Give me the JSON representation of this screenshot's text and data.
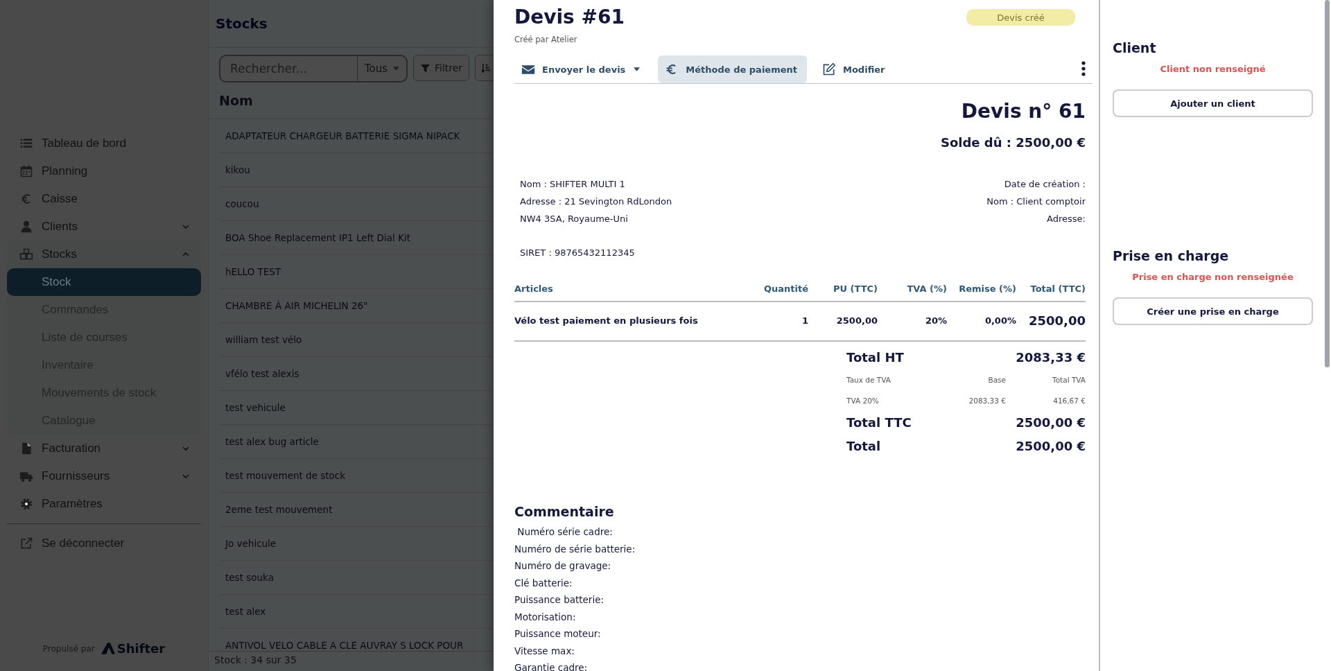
{
  "sidebar": {
    "items": [
      {
        "label": "Tableau de bord",
        "selected": false
      },
      {
        "label": "Planning",
        "selected": false
      },
      {
        "label": "Caisse",
        "selected": false
      },
      {
        "label": "Clients",
        "selected": false,
        "expanded": false
      },
      {
        "label": "Stocks",
        "selected": false,
        "expanded": true,
        "children": [
          {
            "label": "Stock",
            "selected": true
          },
          {
            "label": "Commandes",
            "selected": false
          },
          {
            "label": "Liste de courses",
            "selected": false
          },
          {
            "label": "Inventaire",
            "selected": false
          },
          {
            "label": "Mouvements de stock",
            "selected": false
          },
          {
            "label": "Catalogue",
            "selected": false
          }
        ]
      },
      {
        "label": "Facturation",
        "selected": false,
        "expanded": false
      },
      {
        "label": "Fournisseurs",
        "selected": false,
        "expanded": false
      },
      {
        "label": "Paramètres",
        "selected": false
      }
    ],
    "logout": "Se déconnecter",
    "footer": {
      "powered_by": "Propulsé par",
      "brand": "Shifter"
    }
  },
  "stock_list": {
    "title": "Stocks",
    "search": {
      "placeholder": "Rechercher...",
      "scope": "Tous"
    },
    "filter_button": "Filtrer",
    "columns": [
      "Nom"
    ],
    "rows": [
      "ADAPTATEUR CHARGEUR BATTERIE SIGMA NIPACK",
      "kikou",
      "coucou",
      "BOA Shoe Replacement IP1 Left Dial Kit",
      "hELLO TEST",
      "CHAMBRE À AIR MICHELIN 26\"",
      "william test vélo",
      "vfélo test alexis",
      "test vehicule",
      "test alex bug article",
      "test mouvement de stock",
      "2eme test mouvement",
      "Jo vehicule",
      "test souka",
      "test alex",
      "ANTIVOL VELO CABLE A CLE AUVRAY S LOCK POUR"
    ],
    "footer": "Stock : 34 sur 35"
  },
  "quote": {
    "title": "Devis #61",
    "status": "Devis créé",
    "created_by": "Créé par Atelier",
    "actions": [
      {
        "label": "Envoyer le devis",
        "kind": "send",
        "selected": false
      },
      {
        "label": "Méthode de paiement",
        "kind": "payment",
        "selected": true
      },
      {
        "label": "Modifier",
        "kind": "edit",
        "selected": false
      }
    ],
    "document": {
      "heading": "Devis n° 61",
      "balance": "Solde dû : 2500,00 €",
      "issuer": [
        "Nom : SHIFTER MULTI 1",
        "Adresse : 21 Sevington RdLondon",
        "NW4 3SA, Royaume-Uni"
      ],
      "siret": "SIRET : 98765432112345",
      "recipient": [
        "Date de création :",
        "Nom : Client comptoir",
        "Adresse:"
      ],
      "table": {
        "columns": [
          "Articles",
          "Quantité",
          "PU (TTC)",
          "TVA (%)",
          "Remise (%)",
          "Total (TTC)"
        ],
        "rows": [
          [
            "Vélo test paiement en plusieurs fois",
            "1",
            "2500,00",
            "20%",
            "0,00%",
            "2500,00"
          ]
        ]
      },
      "totals": {
        "total_ht": {
          "label": "Total HT",
          "value": "2083,33 €"
        },
        "vat_columns": [
          "Taux de TVA",
          "Base",
          "Total TVA"
        ],
        "vat_rows": [
          [
            "TVA 20%",
            "2083,33 €",
            "416,67 €"
          ]
        ],
        "total_ttc": {
          "label": "Total TTC",
          "value": "2500,00 €"
        },
        "total": {
          "label": "Total",
          "value": "2500,00 €"
        }
      },
      "comment": {
        "title": "Commentaire",
        "lines": [
          " Numéro série cadre:",
          "Numéro de série batterie:",
          "Numéro de gravage:",
          "Clé batterie:",
          "Puissance batterie:",
          "Motorisation:",
          "Puissance moteur:",
          "Vitesse max:",
          "Garantie cadre:"
        ]
      }
    },
    "side_panel": [
      {
        "title": "Client",
        "notice": "Client non renseigné",
        "button": "Ajouter un client"
      },
      {
        "title": "Prise en charge",
        "notice": "Prise en charge non renseignée",
        "button": "Créer une prise en charge"
      }
    ]
  }
}
